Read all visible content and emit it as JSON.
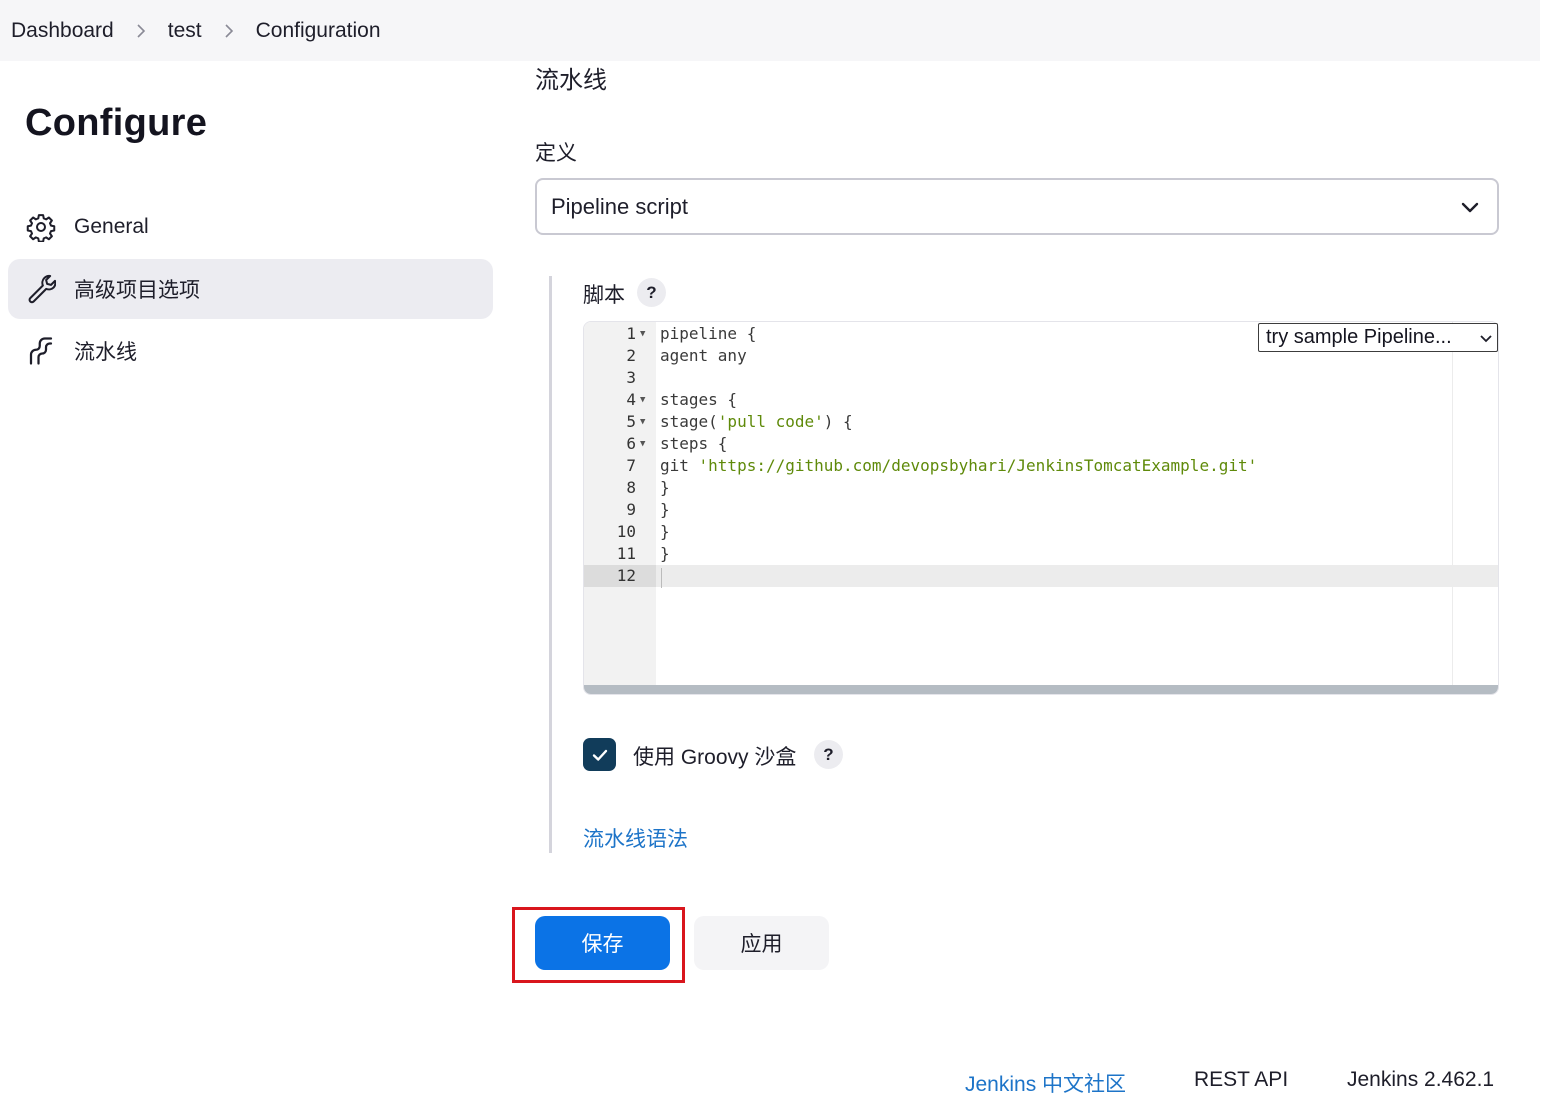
{
  "breadcrumb": {
    "items": [
      "Dashboard",
      "test",
      "Configuration"
    ]
  },
  "sidebar": {
    "title": "Configure",
    "items": [
      {
        "label": "General",
        "icon": "gear-icon",
        "active": false
      },
      {
        "label": "高级项目选项",
        "icon": "wrench-icon",
        "active": true
      },
      {
        "label": "流水线",
        "icon": "pipeline-icon",
        "active": false
      }
    ]
  },
  "main": {
    "section_title": "流水线",
    "definition_label": "定义",
    "definition_value": "Pipeline script",
    "script_label": "脚本",
    "help_glyph": "?",
    "sample_select": "try sample Pipeline...",
    "code_lines": [
      {
        "n": "1",
        "fold": true,
        "pre": "pipeline {",
        "str": "",
        "post": ""
      },
      {
        "n": "2",
        "fold": false,
        "pre": "agent any",
        "str": "",
        "post": ""
      },
      {
        "n": "3",
        "fold": false,
        "pre": "",
        "str": "",
        "post": ""
      },
      {
        "n": "4",
        "fold": true,
        "pre": "stages {",
        "str": "",
        "post": ""
      },
      {
        "n": "5",
        "fold": true,
        "pre": "stage(",
        "str": "'pull code'",
        "post": ") {"
      },
      {
        "n": "6",
        "fold": true,
        "pre": "steps {",
        "str": "",
        "post": ""
      },
      {
        "n": "7",
        "fold": false,
        "pre": "git ",
        "str": "'https://github.com/devopsbyhari/JenkinsTomcatExample.git'",
        "post": ""
      },
      {
        "n": "8",
        "fold": false,
        "pre": "}",
        "str": "",
        "post": ""
      },
      {
        "n": "9",
        "fold": false,
        "pre": "}",
        "str": "",
        "post": ""
      },
      {
        "n": "10",
        "fold": false,
        "pre": "}",
        "str": "",
        "post": ""
      },
      {
        "n": "11",
        "fold": false,
        "pre": "}",
        "str": "",
        "post": ""
      },
      {
        "n": "12",
        "fold": false,
        "pre": "",
        "str": "",
        "post": ""
      }
    ],
    "sandbox_label": "使用 Groovy 沙盒",
    "sandbox_checked": true,
    "syntax_link": "流水线语法"
  },
  "actions": {
    "save_label": "保存",
    "apply_label": "应用"
  },
  "footer": {
    "community": "Jenkins 中文社区",
    "rest_api": "REST API",
    "version": "Jenkins 2.462.1"
  },
  "colors": {
    "primary": "#0b73e6",
    "link": "#1d74c8",
    "checkbox": "#113c5a",
    "highlight": "#d9161d",
    "code_string": "#5f8a0a"
  }
}
